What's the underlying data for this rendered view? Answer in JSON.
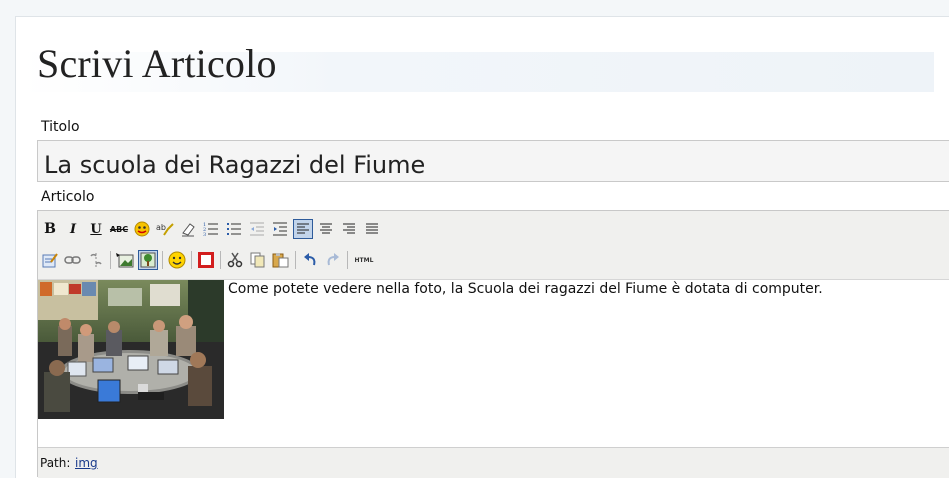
{
  "page": {
    "heading": "Scrivi Articolo",
    "title_label": "Titolo",
    "title_value": "La scuola dei Ragazzi del Fiume",
    "article_label": "Articolo"
  },
  "toolbar": {
    "row1": [
      {
        "name": "bold-button",
        "glyph": "B"
      },
      {
        "name": "italic-button",
        "glyph": "I"
      },
      {
        "name": "underline-button",
        "glyph": "U"
      },
      {
        "name": "strikethrough-button",
        "glyph": "ABC"
      },
      {
        "name": "spellcheck-button",
        "icon": "spellcheck-icon"
      },
      {
        "name": "spelling-abc-button",
        "icon": "abc-check-icon"
      },
      {
        "name": "remove-format-button",
        "icon": "eraser-icon"
      },
      {
        "name": "ordered-list-button",
        "icon": "ordered-list-icon"
      },
      {
        "name": "unordered-list-button",
        "icon": "unordered-list-icon"
      },
      {
        "name": "outdent-button",
        "icon": "outdent-icon"
      },
      {
        "name": "indent-button",
        "icon": "indent-icon"
      },
      {
        "name": "align-left-button",
        "icon": "align-left-icon",
        "active": true
      },
      {
        "name": "align-center-button",
        "icon": "align-center-icon"
      },
      {
        "name": "align-right-button",
        "icon": "align-right-icon"
      },
      {
        "name": "align-justify-button",
        "icon": "align-justify-icon"
      }
    ],
    "row2": [
      {
        "name": "edit-button",
        "icon": "edit-icon"
      },
      {
        "name": "link-button",
        "icon": "link-icon"
      },
      {
        "name": "unlink-button",
        "icon": "unlink-icon"
      },
      {
        "name": "insert-image-button",
        "icon": "insert-image-icon"
      },
      {
        "name": "image-properties-button",
        "icon": "image-tree-icon",
        "active": true
      },
      {
        "name": "smiley-button",
        "icon": "smiley-icon"
      },
      {
        "name": "media-button",
        "icon": "red-square-icon"
      },
      {
        "name": "cut-button",
        "icon": "scissors-icon"
      },
      {
        "name": "copy-button",
        "icon": "copy-icon"
      },
      {
        "name": "paste-button",
        "icon": "paste-icon"
      },
      {
        "name": "undo-button",
        "icon": "undo-icon"
      },
      {
        "name": "redo-button",
        "icon": "redo-icon"
      },
      {
        "name": "html-button",
        "glyph": "HTML"
      }
    ]
  },
  "editor": {
    "body_text": "Come potete vedere nella foto, la Scuola dei ragazzi del Fiume è dotata di computer.",
    "image_alt": "photo of students at computers"
  },
  "statusbar": {
    "path_label": "Path:",
    "path_value": "img"
  },
  "colors": {
    "accent": "#2e5b9a",
    "toolbar_bg": "#f0f0ee",
    "link": "#1a3b8c"
  }
}
